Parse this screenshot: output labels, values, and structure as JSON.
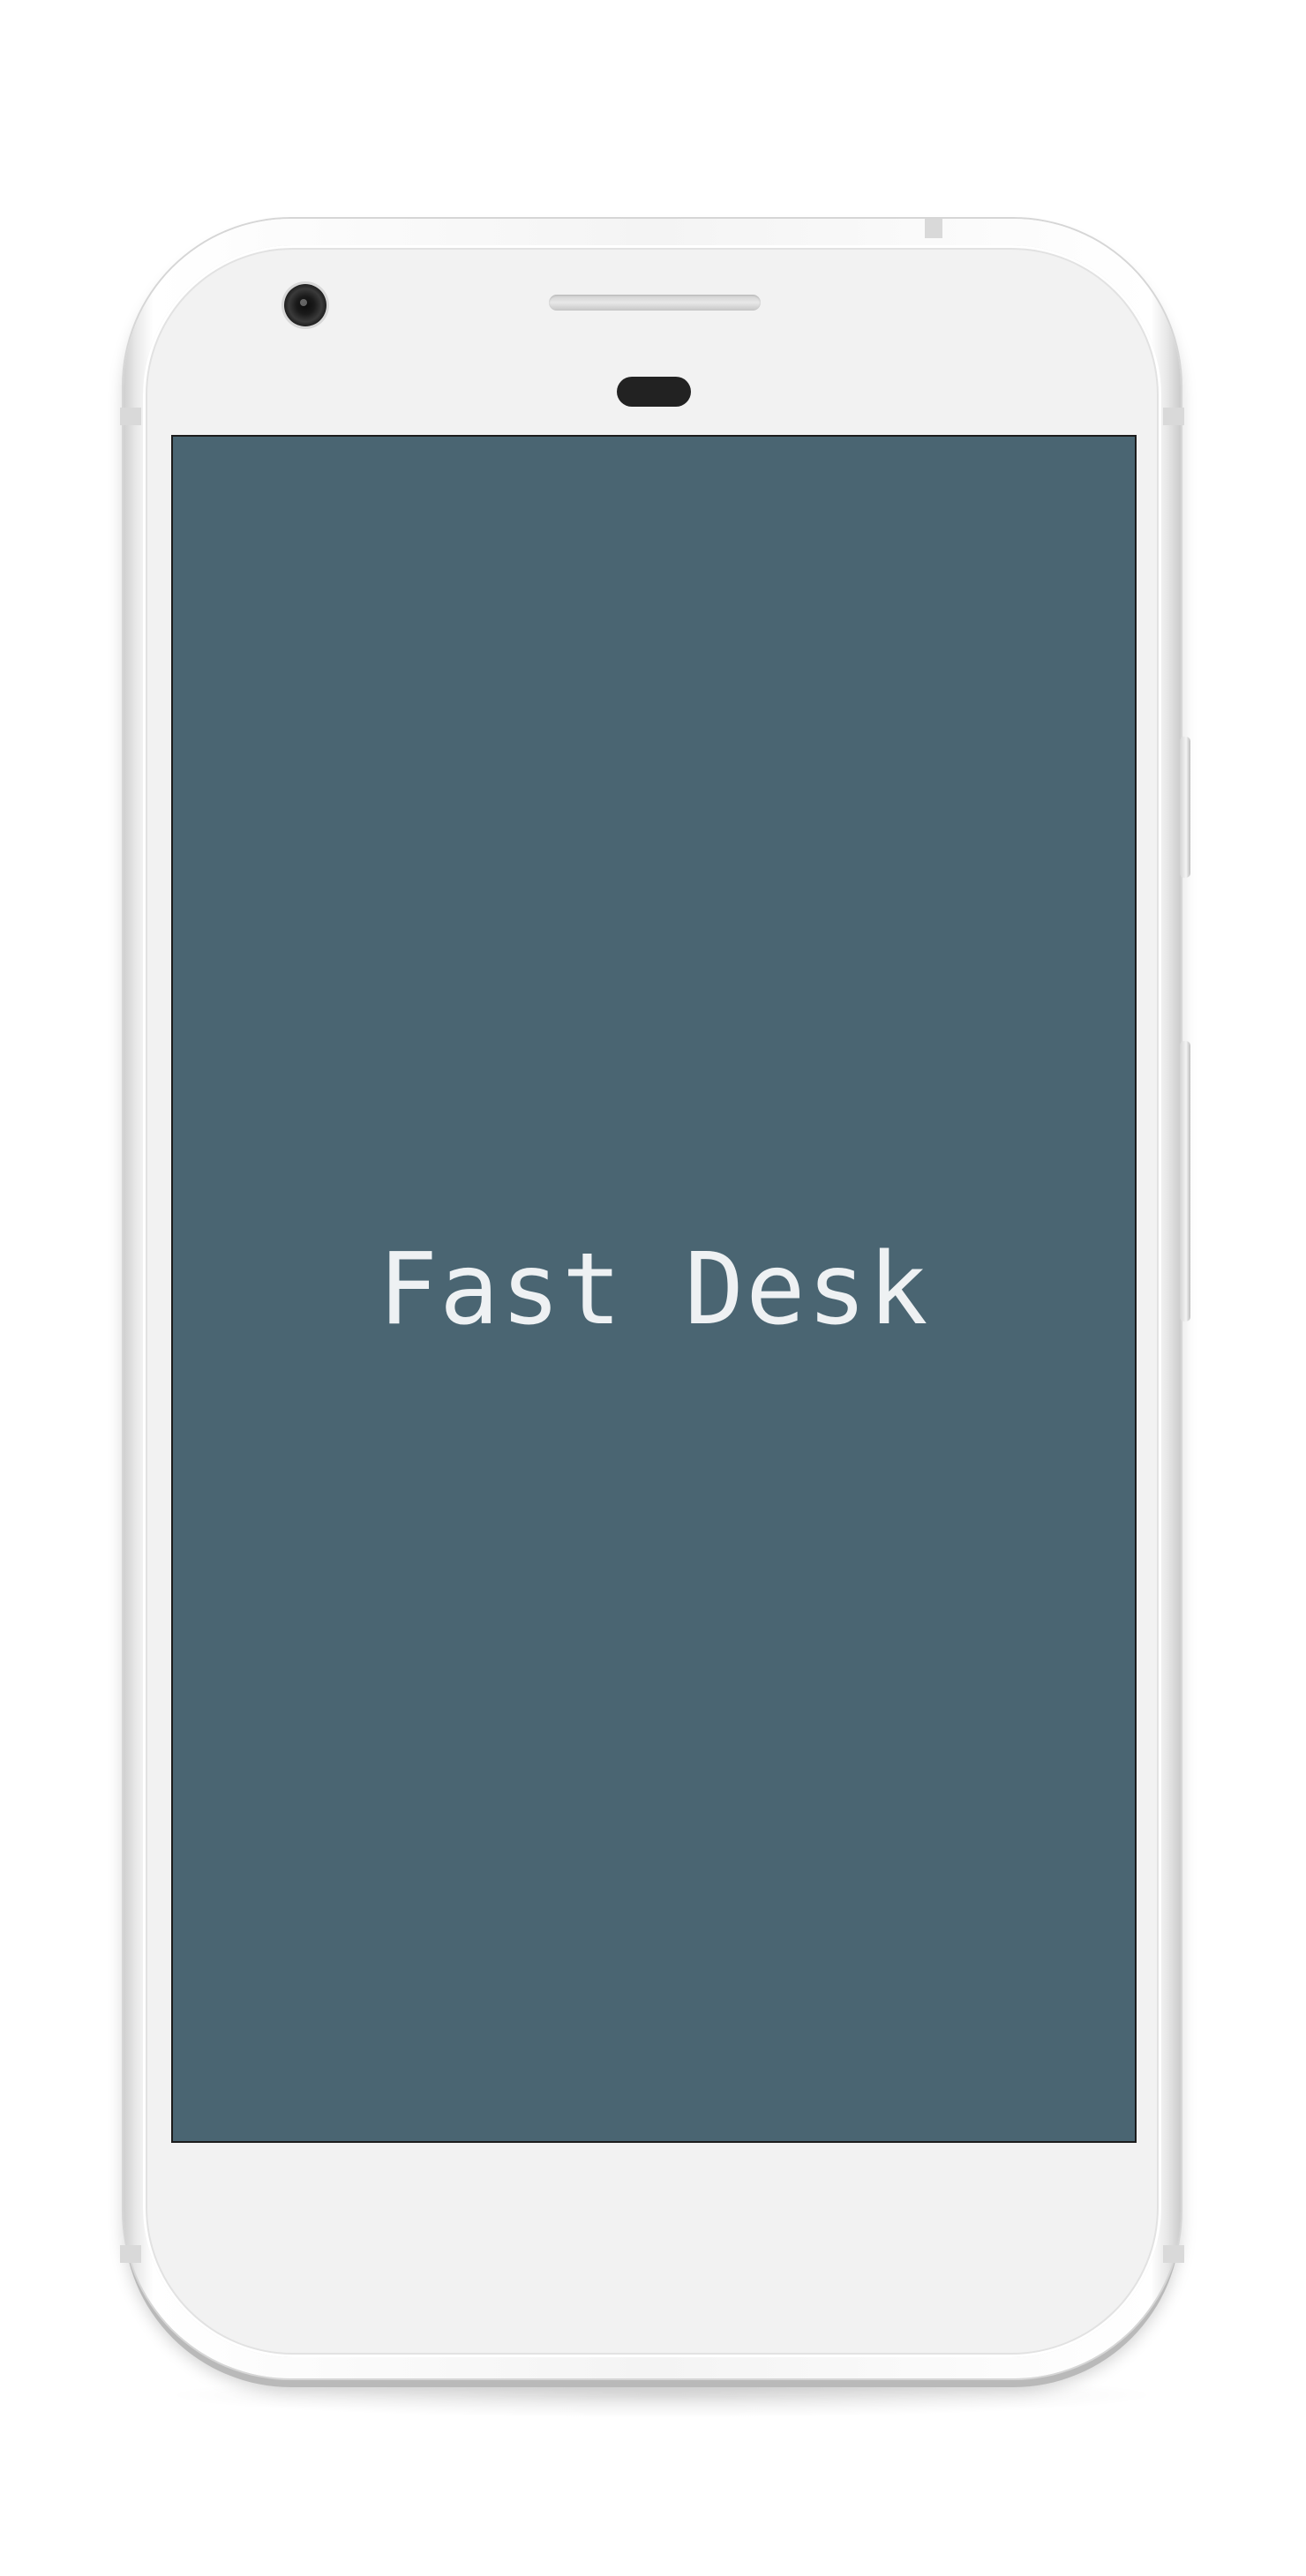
{
  "app": {
    "title": "Fast Desk"
  },
  "theme": {
    "screen_background": "#4a6572",
    "title_color": "#eef1f3",
    "device_body": "#f2f2f2"
  },
  "device": {
    "front_camera_icon": "camera-lens-icon",
    "earpiece_icon": "speaker-grille-icon",
    "sensor_icon": "proximity-sensor-icon"
  }
}
